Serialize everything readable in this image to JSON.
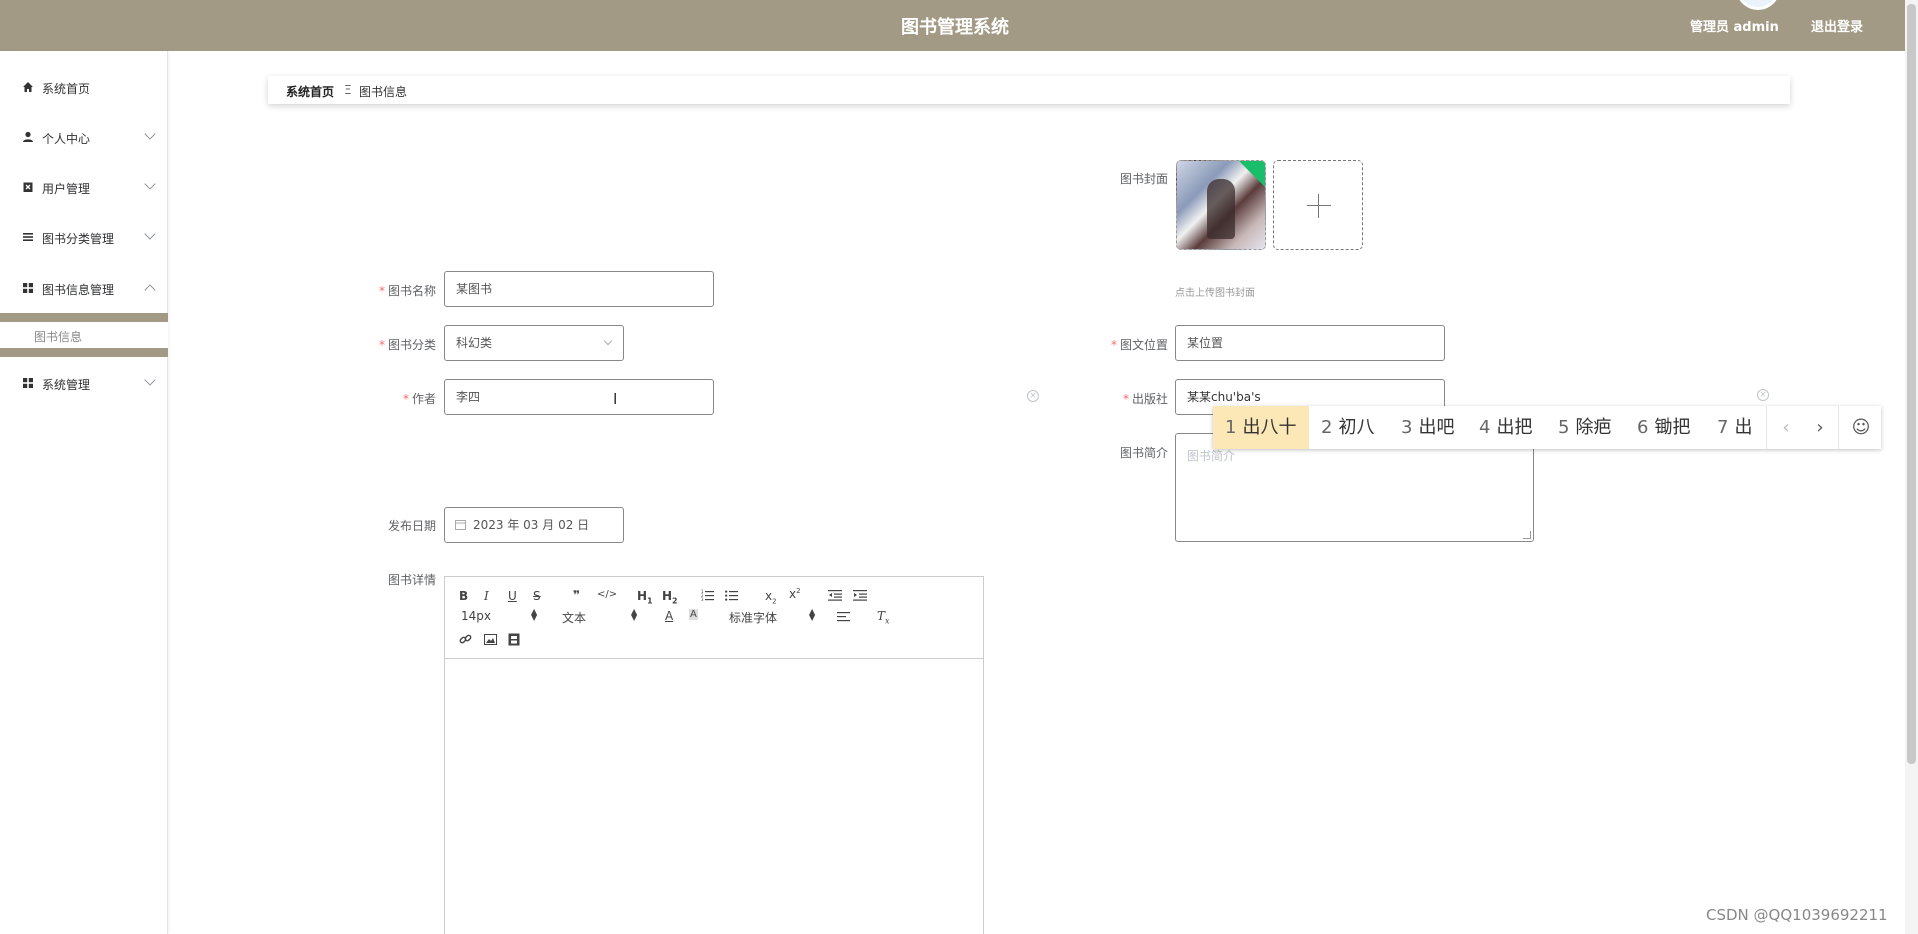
{
  "header": {
    "title": "图书管理系统",
    "user": "管理员 admin",
    "logout": "退出登录"
  },
  "sidebar": {
    "items": [
      {
        "label": "系统首页",
        "icon": "home-icon"
      },
      {
        "label": "个人中心",
        "icon": "person-icon"
      },
      {
        "label": "用户管理",
        "icon": "user-manage-icon"
      },
      {
        "label": "图书分类管理",
        "icon": "list-icon"
      },
      {
        "label": "图书信息管理",
        "icon": "grid-icon"
      },
      {
        "label": "系统管理",
        "icon": "grid-icon"
      }
    ],
    "sub_item": "图书信息"
  },
  "breadcrumb": {
    "home": "系统首页",
    "separator": "Ξ",
    "current": "图书信息"
  },
  "form": {
    "cover_label": "图书封面",
    "upload_tip": "点击上传图书封面",
    "name_label": "图书名称",
    "name_value": "某图书",
    "category_label": "图书分类",
    "category_value": "科幻类",
    "location_label": "图文位置",
    "location_value": "某位置",
    "author_label": "作者",
    "author_value": "李四",
    "publisher_label": "出版社",
    "publisher_value": "某某chu'ba's",
    "intro_label": "图书简介",
    "intro_placeholder": "图书简介",
    "date_label": "发布日期",
    "date_value": "2023 年 03 月 02 日",
    "detail_label": "图书详情"
  },
  "ime": {
    "candidates": [
      {
        "num": "1",
        "text": "出八十"
      },
      {
        "num": "2",
        "text": "初八"
      },
      {
        "num": "3",
        "text": "出吧"
      },
      {
        "num": "4",
        "text": "出把"
      },
      {
        "num": "5",
        "text": "除疤"
      },
      {
        "num": "6",
        "text": "锄把"
      },
      {
        "num": "7",
        "text": "出"
      }
    ],
    "prev": "‹",
    "next": "›",
    "emoji": "☺"
  },
  "editor": {
    "font_size": "14px",
    "block_type": "文本",
    "font_family": "标准字体"
  },
  "watermark": "CSDN @QQ1039692211",
  "colors": {
    "header_bg": "#a39a86",
    "ime_active": "#fbe8b6",
    "required": "#f56c6c"
  }
}
